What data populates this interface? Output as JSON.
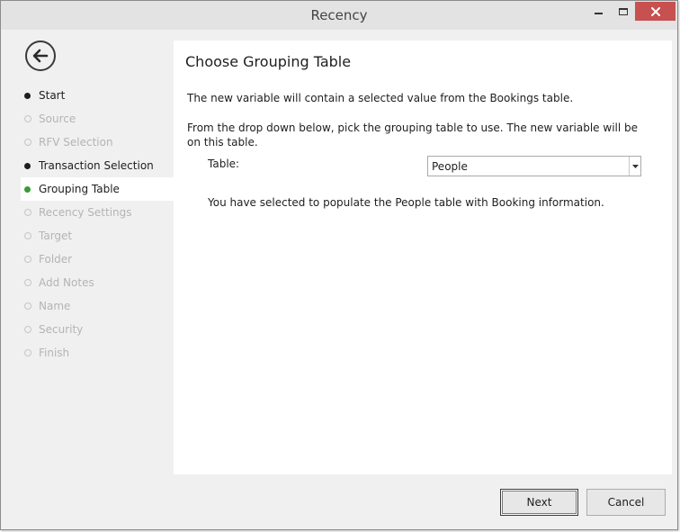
{
  "window": {
    "title": "Recency"
  },
  "colors": {
    "close": "#c75050",
    "current_dot": "#3a9a3a",
    "pending": "#b4b4b4"
  },
  "icons": {
    "back": "back-arrow-icon",
    "minimize": "minimize-icon",
    "maximize": "maximize-icon",
    "close": "close-icon",
    "dropdown": "chevron-down-icon"
  },
  "sidebar": {
    "steps": [
      {
        "label": "Start",
        "state": "done"
      },
      {
        "label": "Source",
        "state": "pending"
      },
      {
        "label": "RFV Selection",
        "state": "pending"
      },
      {
        "label": "Transaction Selection",
        "state": "done"
      },
      {
        "label": "Grouping Table",
        "state": "current"
      },
      {
        "label": "Recency Settings",
        "state": "pending"
      },
      {
        "label": "Target",
        "state": "pending"
      },
      {
        "label": "Folder",
        "state": "pending"
      },
      {
        "label": "Add Notes",
        "state": "pending"
      },
      {
        "label": "Name",
        "state": "pending"
      },
      {
        "label": "Security",
        "state": "pending"
      },
      {
        "label": "Finish",
        "state": "pending"
      }
    ]
  },
  "main": {
    "heading": "Choose Grouping Table",
    "p1": "The new variable will contain a selected value from the Bookings table.",
    "p2": "From the drop down below, pick the grouping table to use. The new variable will be on this table.",
    "table_label": "Table:",
    "table_value": "People",
    "info": "You have selected to populate the People table with Booking information."
  },
  "footer": {
    "next_label": "Next",
    "cancel_label": "Cancel"
  }
}
